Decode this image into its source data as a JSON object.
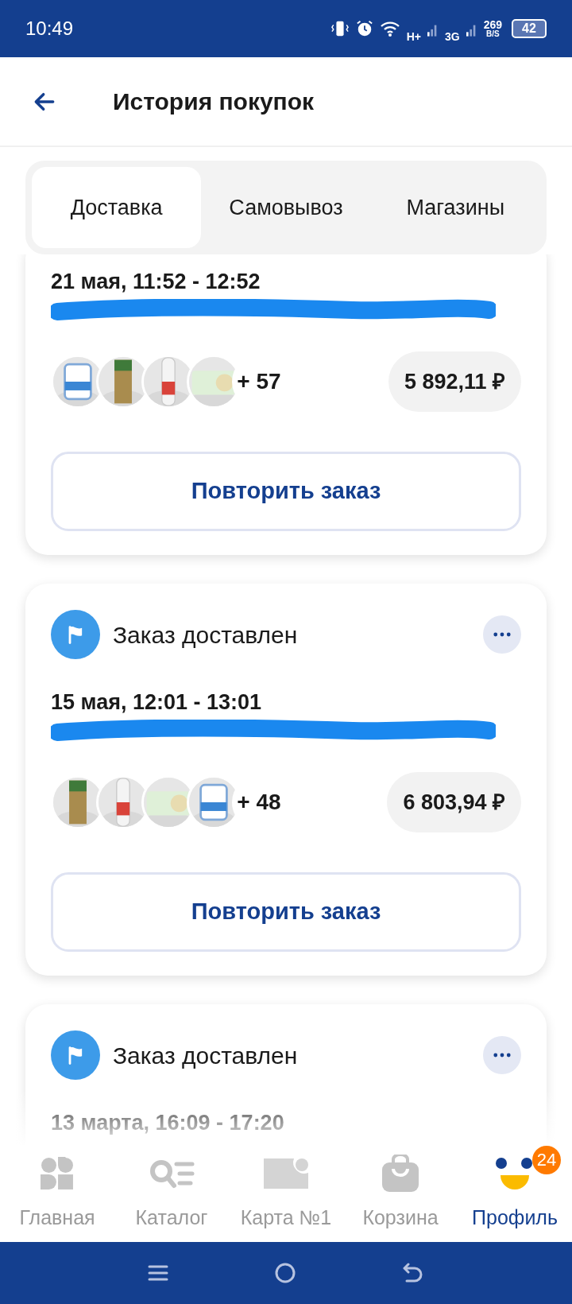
{
  "status_bar": {
    "time": "10:49",
    "network_1": "H+",
    "network_2": "3G",
    "speed": "269",
    "speed_unit": "B/S",
    "battery": "42"
  },
  "header": {
    "title": "История покупок"
  },
  "tabs": [
    {
      "label": "Доставка",
      "selected": true
    },
    {
      "label": "Самовывоз",
      "selected": false
    },
    {
      "label": "Магазины",
      "selected": false
    }
  ],
  "orders": [
    {
      "date": "21 мая, 11:52 - 12:52",
      "address_redacted": true,
      "items_more": "+ 57",
      "total": "5 892,11 ₽",
      "button": "Повторить заказ"
    },
    {
      "status": "Заказ доставлен",
      "date": "15 мая, 12:01 - 13:01",
      "address_redacted": true,
      "items_more": "+ 48",
      "total": "6 803,94 ₽",
      "button": "Повторить заказ"
    },
    {
      "status": "Заказ доставлен",
      "date": "13 марта, 16:09 - 17:20",
      "address_redacted": false
    }
  ],
  "bottom_nav": [
    {
      "label": "Главная",
      "selected": false
    },
    {
      "label": "Каталог",
      "selected": false
    },
    {
      "label": "Карта №1",
      "selected": false
    },
    {
      "label": "Корзина",
      "selected": false
    },
    {
      "label": "Профиль",
      "selected": true,
      "badge": "24"
    }
  ]
}
